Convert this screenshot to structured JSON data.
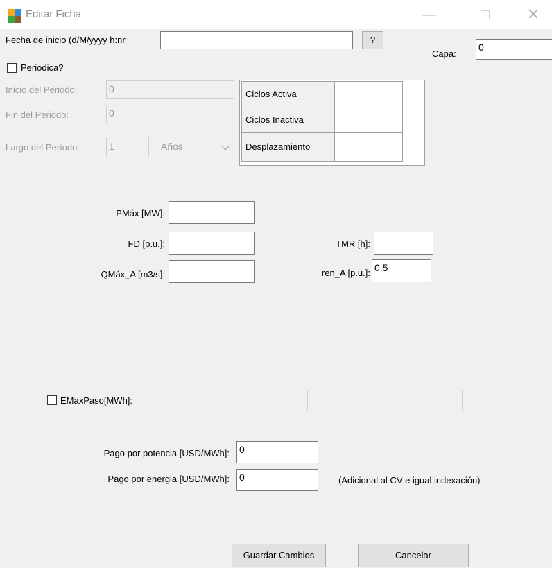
{
  "window": {
    "title": "Editar Ficha",
    "min_glyph": "—",
    "close_glyph": "✕"
  },
  "fecha": {
    "label": "Fecha de inicio (d/M/yyyy h:nr",
    "value": "",
    "help_label": "?"
  },
  "capa": {
    "label": "Capa:",
    "value": "0"
  },
  "periodica": {
    "label": "Periodica?",
    "inicio_label": "Inicio del Periodo:",
    "inicio_value": "0",
    "fin_label": "Fin del Periodo:",
    "fin_value": "0",
    "largo_label": "Largo del Período:",
    "largo_value": "1",
    "unidad_value": "Años"
  },
  "ciclos": {
    "rows": [
      {
        "label": "Ciclos Activa",
        "value": ""
      },
      {
        "label": "Ciclos Inactiva",
        "value": ""
      },
      {
        "label": "Desplazamiento",
        "value": ""
      }
    ]
  },
  "params": {
    "pmax_label": "PMáx [MW]:",
    "pmax_value": "",
    "fd_label": "FD [p.u.]:",
    "fd_value": "",
    "qmax_label": "QMáx_A [m3/s]:",
    "qmax_value": "",
    "tmr_label": "TMR [h]:",
    "tmr_value": "",
    "ren_label": "ren_A [p.u.]:",
    "ren_value": "0.5"
  },
  "emax": {
    "label": "EMaxPaso[MWh]:",
    "value": ""
  },
  "pago": {
    "potencia_label": "Pago por potencia [USD/MWh]:",
    "potencia_value": "0",
    "energia_label": "Pago por energia  [USD/MWh]:",
    "energia_value": "0",
    "note": "(Adicional al CV e igual indexación)"
  },
  "buttons": {
    "guardar": "Guardar Cambios",
    "cancelar": "Cancelar"
  },
  "colors": {
    "icon_orange": "#f5a623",
    "icon_blue": "#2b8fd8",
    "icon_green": "#3ea63e",
    "icon_brown": "#8b5a2b"
  }
}
